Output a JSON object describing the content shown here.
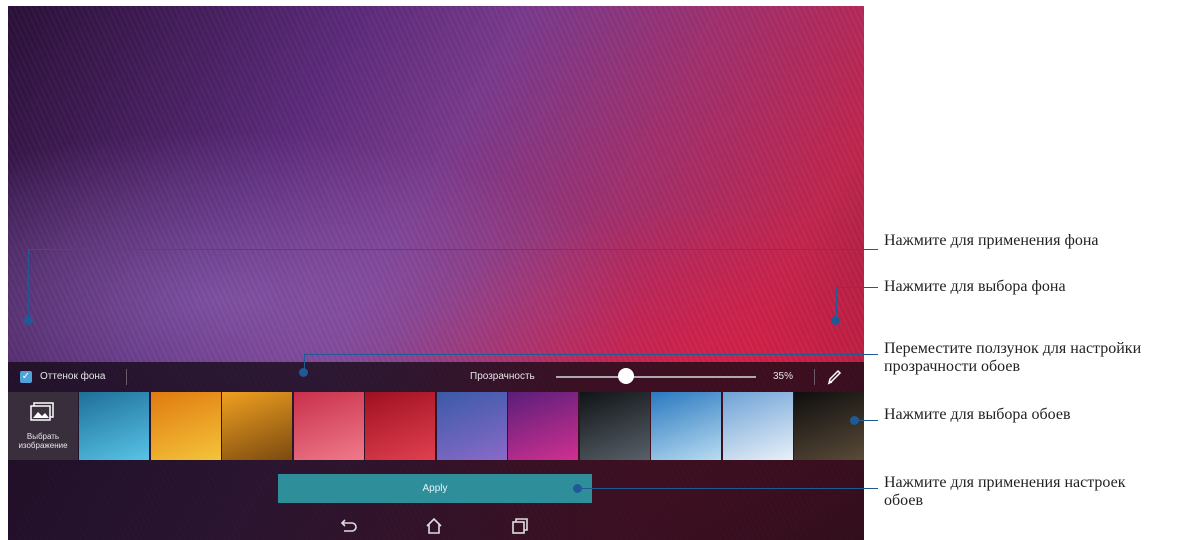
{
  "panel": {
    "tint_label": "Оттенок фона",
    "tint_checked": true,
    "opacity_label": "Прозрачность",
    "opacity_value": "35%",
    "opacity_level": 0.35,
    "pick_image_label": "Выбрать изображение",
    "apply_label": "Apply",
    "thumbnails": [
      {
        "name": "thumb-water",
        "colors": [
          "#1e6f9a",
          "#58c3e6"
        ]
      },
      {
        "name": "thumb-orange-rope",
        "colors": [
          "#e07a10",
          "#f4c43a"
        ]
      },
      {
        "name": "thumb-sunset",
        "colors": [
          "#f0a020",
          "#7a4a10"
        ]
      },
      {
        "name": "thumb-red-dunes",
        "colors": [
          "#c8304a",
          "#f07a8a"
        ]
      },
      {
        "name": "thumb-red-sky",
        "colors": [
          "#a01020",
          "#e04050"
        ]
      },
      {
        "name": "thumb-lavender-field",
        "colors": [
          "#3a5aa8",
          "#8a6ac8"
        ]
      },
      {
        "name": "thumb-purple-asus",
        "colors": [
          "#5a1e7a",
          "#d03090"
        ]
      },
      {
        "name": "thumb-mountains-night",
        "colors": [
          "#101418",
          "#586068"
        ]
      },
      {
        "name": "thumb-blue-winter",
        "colors": [
          "#2a78c0",
          "#b8dcf0"
        ]
      },
      {
        "name": "thumb-snow-peaks",
        "colors": [
          "#6ea2d6",
          "#e8f0f8"
        ]
      },
      {
        "name": "thumb-vinyl",
        "colors": [
          "#0e0e0e",
          "#5a4a38"
        ]
      }
    ]
  },
  "annotations": [
    {
      "name": "annotation-apply-background",
      "text": "Нажмите для применения фона"
    },
    {
      "name": "annotation-select-background",
      "text": "Нажмите для выбора фона"
    },
    {
      "name": "annotation-slider",
      "text": "Переместите ползунок для настройки прозрачности обоев"
    },
    {
      "name": "annotation-select-wallpaper",
      "text": "Нажмите для выбора обоев"
    },
    {
      "name": "annotation-apply-settings",
      "text": "Нажмите для применения настроек обоев"
    }
  ],
  "colors": {
    "accent": "#2e8f9b",
    "callout": "#1f5a96",
    "checkbox": "#4fa3d9"
  }
}
